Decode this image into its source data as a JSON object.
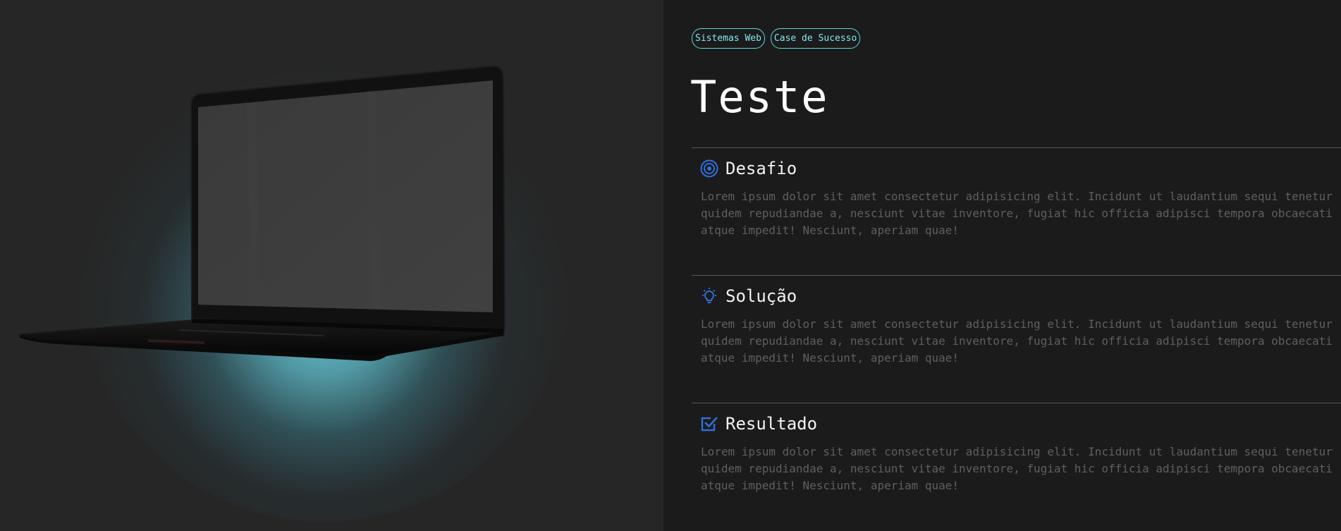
{
  "tags": [
    {
      "label": "Sistemas Web"
    },
    {
      "label": "Case de Sucesso"
    }
  ],
  "title": "Teste",
  "sections": [
    {
      "title": "Desafio",
      "icon": "target-icon",
      "text": "Lorem ipsum dolor sit amet consectetur adipisicing elit. Incidunt ut laudantium sequi tenetur quidem repudiandae a, nesciunt vitae inventore, fugiat hic officia adipisci tempora obcaecati atque impedit! Nesciunt, aperiam quae!"
    },
    {
      "title": "Solução",
      "icon": "lightbulb-icon",
      "text": "Lorem ipsum dolor sit amet consectetur adipisicing elit. Incidunt ut laudantium sequi tenetur quidem repudiandae a, nesciunt vitae inventore, fugiat hic officia adipisci tempora obcaecati atque impedit! Nesciunt, aperiam quae!"
    },
    {
      "title": "Resultado",
      "icon": "checkbox-icon",
      "text": "Lorem ipsum dolor sit amet consectetur adipisicing elit. Incidunt ut laudantium sequi tenetur quidem repudiandae a, nesciunt vitae inventore, fugiat hic officia adipisci tempora obcaecati atque impedit! Nesciunt, aperiam quae!"
    }
  ],
  "colors": {
    "accent": "#5ed6da",
    "icon": "#2f6fdc",
    "glow": "#6ed2e1"
  }
}
